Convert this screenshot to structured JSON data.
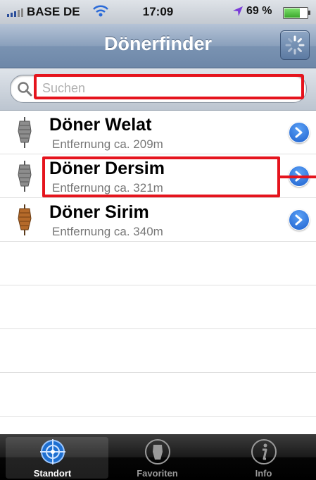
{
  "status_bar": {
    "carrier": "BASE DE",
    "time": "17:09",
    "battery_percent": "69 %"
  },
  "nav": {
    "title": "Dönerfinder"
  },
  "search": {
    "placeholder": "Suchen",
    "value": ""
  },
  "list": {
    "items": [
      {
        "name": "Döner Welat",
        "distance": "Entfernung ca. 209m",
        "icon": "doner-gray"
      },
      {
        "name": "Döner Dersim",
        "distance": "Entfernung ca. 321m",
        "icon": "doner-gray"
      },
      {
        "name": "Döner Sirim",
        "distance": "Entfernung ca. 340m",
        "icon": "doner-brown"
      }
    ]
  },
  "tabs": [
    {
      "label": "Standort",
      "active": true,
      "icon": "target-icon"
    },
    {
      "label": "Favoriten",
      "active": false,
      "icon": "doner-icon"
    },
    {
      "label": "Info",
      "active": false,
      "icon": "info-icon"
    }
  ],
  "colors": {
    "accent": "#1f62cf",
    "highlight": "#e5141d",
    "nav": "#7a93b2"
  }
}
